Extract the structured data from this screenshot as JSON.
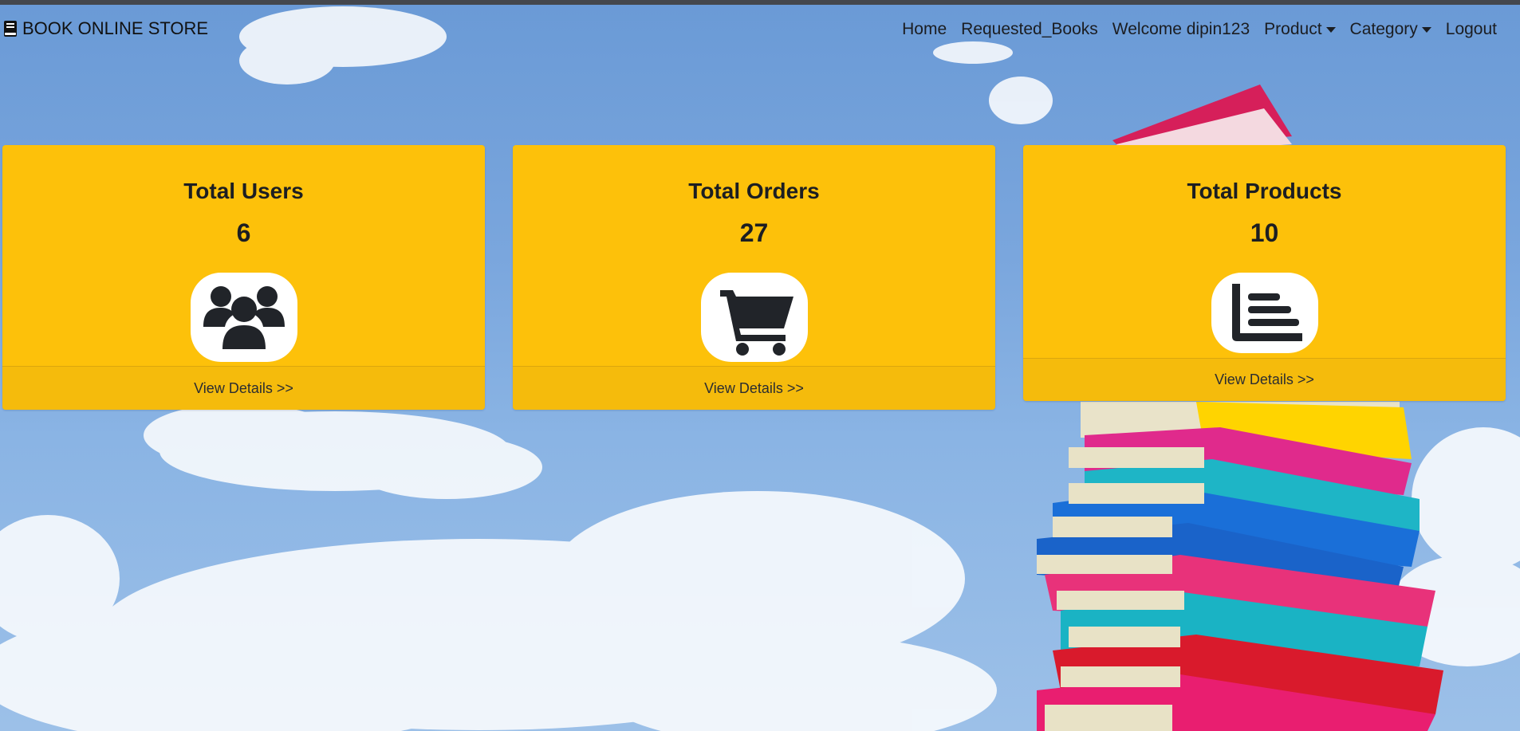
{
  "brand": {
    "name": "BOOK ONLINE STORE",
    "icon": "book-icon"
  },
  "nav": {
    "home": "Home",
    "requested_books": "Requested_Books",
    "welcome": "Welcome dipin123",
    "product": "Product",
    "category": "Category",
    "logout": "Logout"
  },
  "cards": [
    {
      "title": "Total Users",
      "value": "6",
      "icon": "users-icon",
      "link": "View Details >>"
    },
    {
      "title": "Total Orders",
      "value": "27",
      "icon": "cart-icon",
      "link": "View Details >>"
    },
    {
      "title": "Total Products",
      "value": "10",
      "icon": "list-icon",
      "link": "View Details >>"
    }
  ],
  "colors": {
    "card": "#fdc10a",
    "card_footer": "#f5bb0c",
    "text": "#1c1e22"
  }
}
